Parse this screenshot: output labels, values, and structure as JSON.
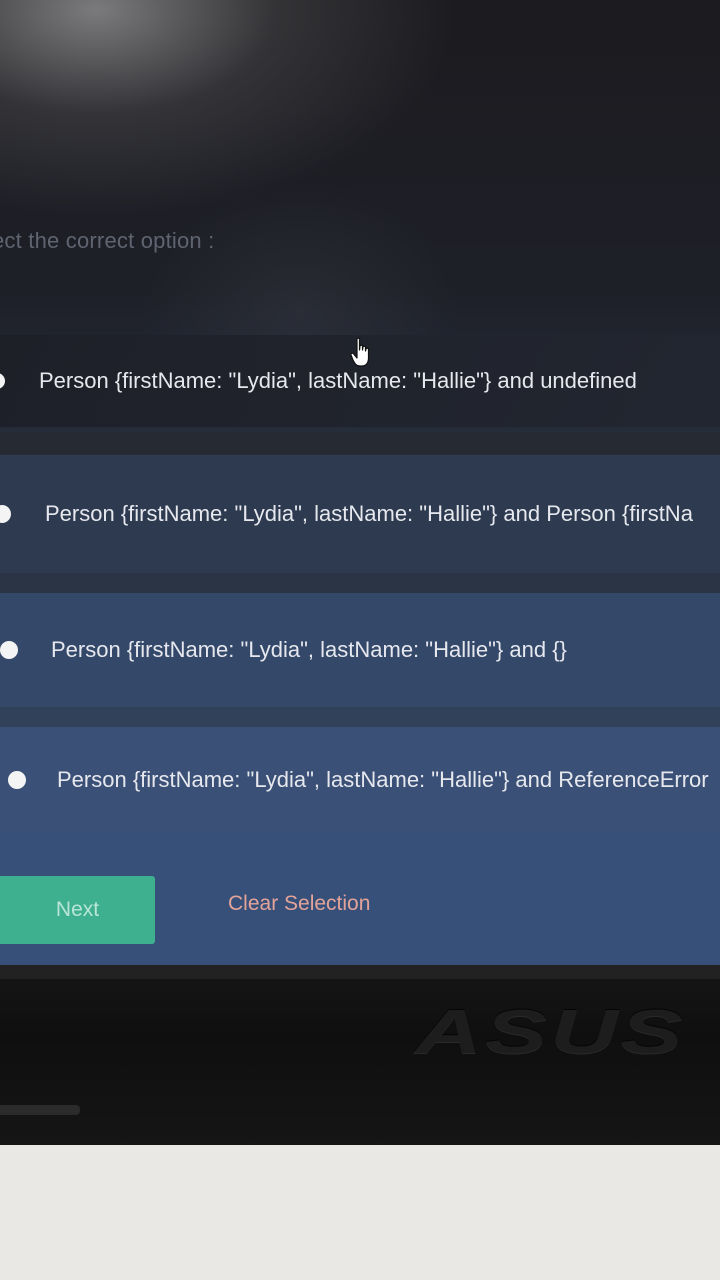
{
  "quiz": {
    "prompt": "ect the correct option :",
    "options": [
      {
        "label": "Person {firstName: \"Lydia\", lastName: \"Hallie\"} and undefined"
      },
      {
        "label": "Person {firstName: \"Lydia\", lastName: \"Hallie\"} and Person {firstNa"
      },
      {
        "label": "Person {firstName: \"Lydia\", lastName: \"Hallie\"} and {}"
      },
      {
        "label": "Person {firstName: \"Lydia\", lastName: \"Hallie\"} and ReferenceError"
      }
    ],
    "next_label": "Next",
    "clear_label": "Clear Selection"
  },
  "device": {
    "logo_text": "ASUS"
  },
  "icons": {
    "radio": "radio-unselected-icon",
    "cursor": "hand-pointer-icon"
  },
  "colors": {
    "next_button": "#3fb08f",
    "clear_link": "#e3a399",
    "option_bg": "#34486a"
  }
}
